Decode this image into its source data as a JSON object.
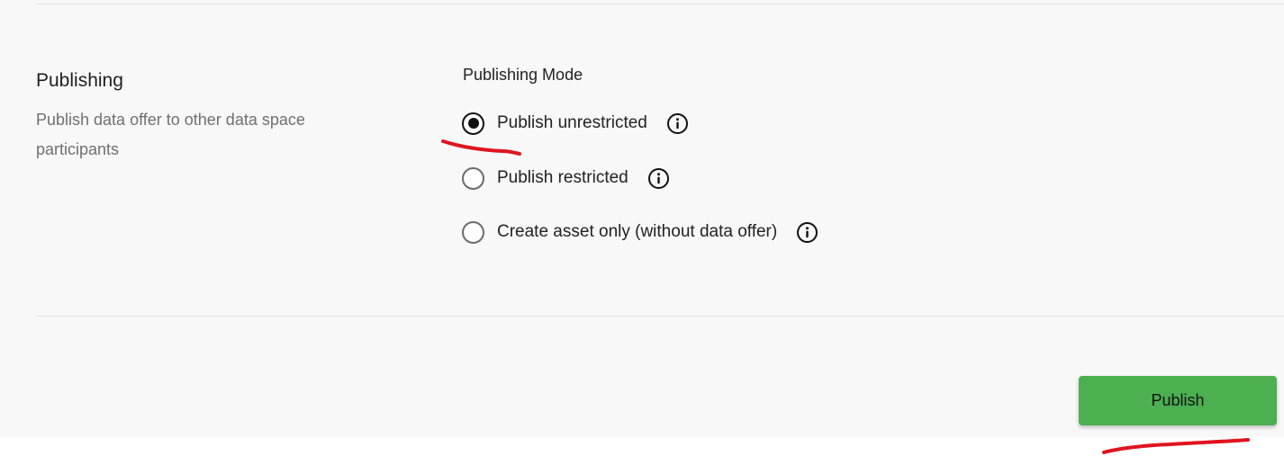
{
  "section": {
    "title": "Publishing",
    "description": "Publish data offer to other data space participants"
  },
  "publishing_mode": {
    "label": "Publishing Mode",
    "selected_index": 0,
    "options": [
      {
        "label": "Publish unrestricted",
        "selected": true,
        "info_icon": "info-icon"
      },
      {
        "label": "Publish restricted",
        "selected": false,
        "info_icon": "info-icon"
      },
      {
        "label": "Create asset only (without data offer)",
        "selected": false,
        "info_icon": "info-icon"
      }
    ]
  },
  "actions": {
    "publish_label": "Publish"
  },
  "colors": {
    "panel_background": "#f8f8f8",
    "publish_button": "#4caf50",
    "annotation_marks": "#e0141e"
  }
}
